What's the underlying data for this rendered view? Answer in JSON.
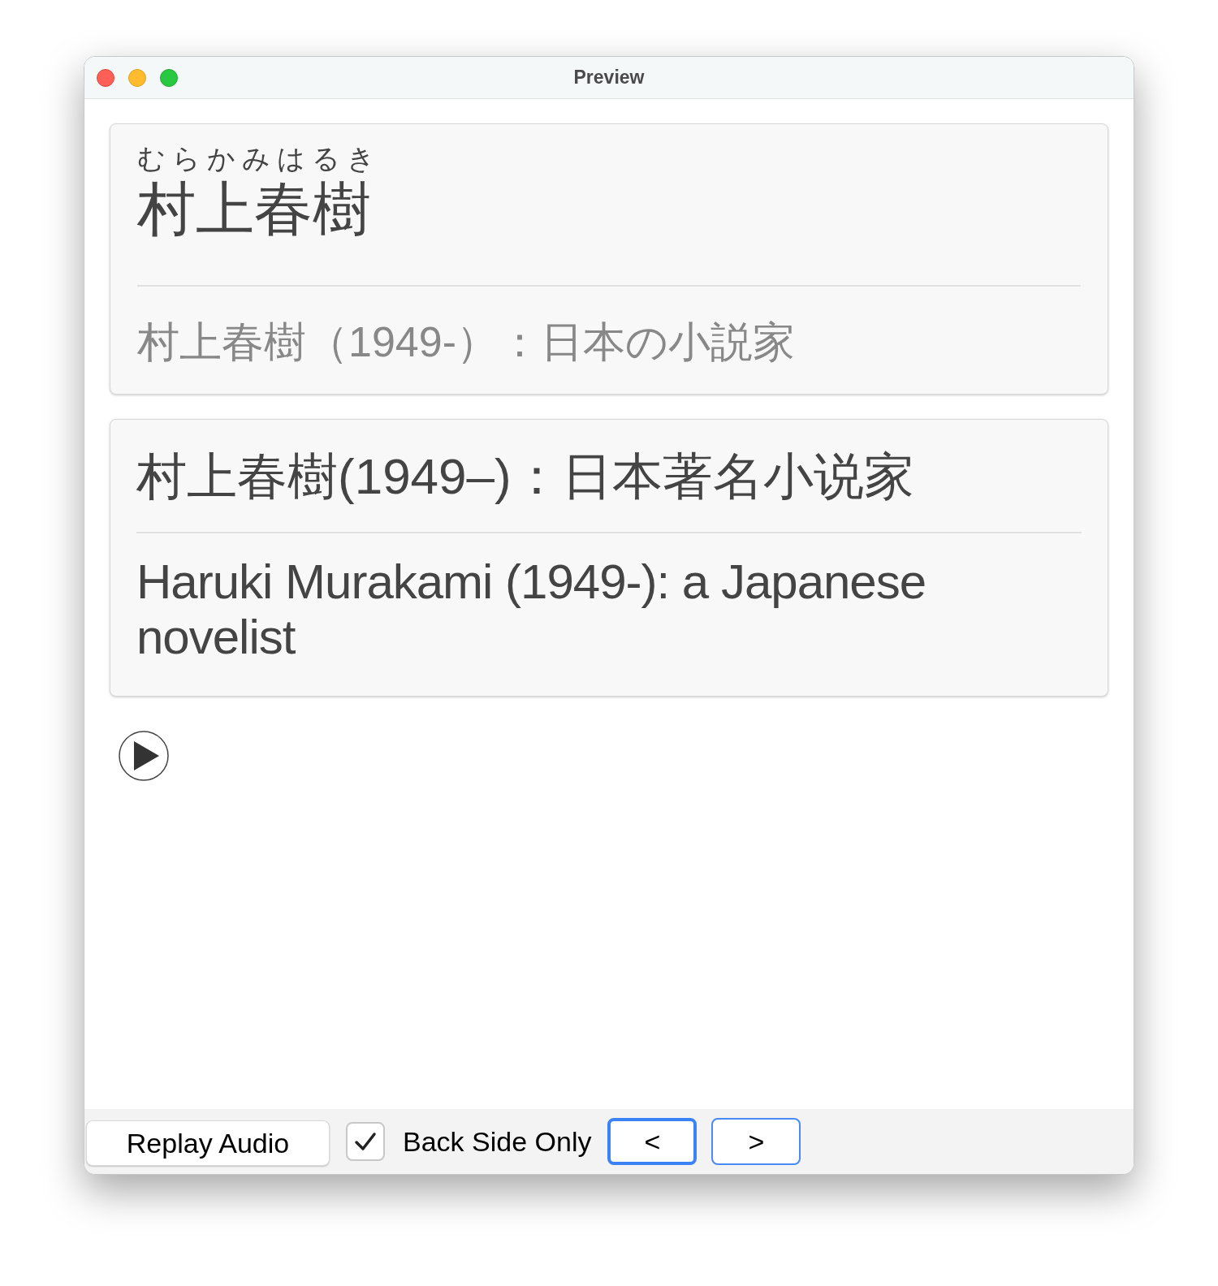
{
  "window": {
    "title": "Preview"
  },
  "front_card": {
    "reading": "むらかみはるき",
    "headword": "村上春樹",
    "definition": "村上春樹（1949-）：日本の小説家"
  },
  "back_card": {
    "chinese": "村上春樹(1949–)：日本著名小说家",
    "english": "Haruki Murakami (1949-): a Japanese novelist"
  },
  "toolbar": {
    "replay_button": "Replay Audio",
    "back_side_only": {
      "label": "Back Side Only",
      "checked": true
    },
    "nav_buttons": [
      {
        "label": "<",
        "focused": true
      },
      {
        "label": ">",
        "focused": false
      }
    ]
  }
}
